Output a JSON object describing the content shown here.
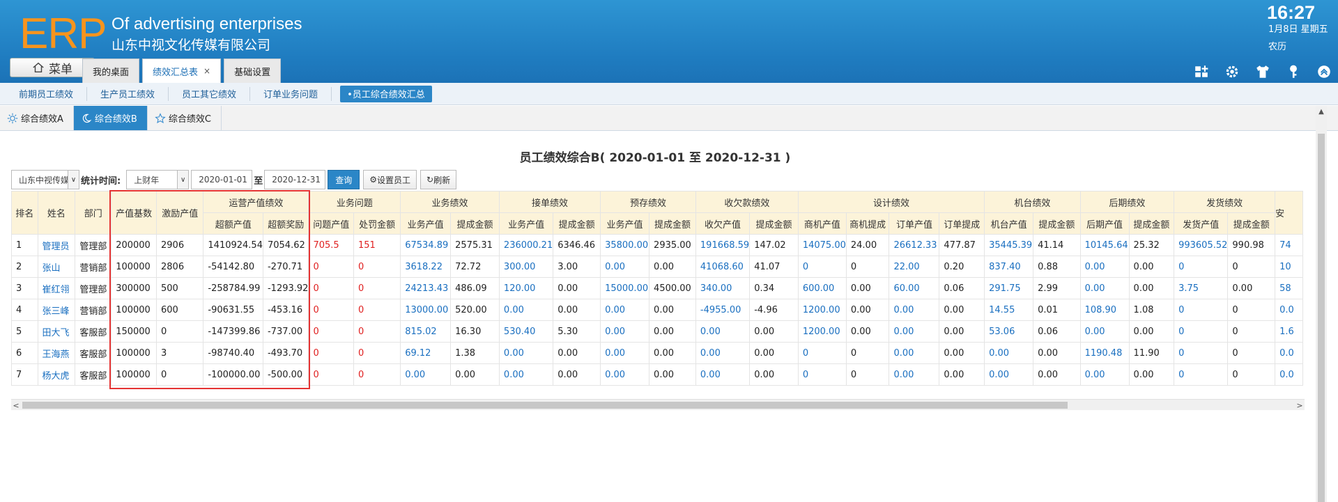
{
  "header": {
    "logo": "ERP",
    "brand_en": "Of advertising enterprises",
    "brand_cn": "山东中视文化传媒有限公司",
    "time": "16:27",
    "date": "1月8日 星期五",
    "lunar": "农历",
    "menu_label": "菜单",
    "tabs": [
      {
        "label": "我的桌面"
      },
      {
        "label": "绩效汇总表",
        "close": "×"
      },
      {
        "label": "基础设置"
      }
    ]
  },
  "subnav": [
    "前期员工绩效",
    "生产员工绩效",
    "员工其它绩效",
    "订单业务问题",
    "•员工综合绩效汇总"
  ],
  "subtabs": [
    "综合绩效A",
    "综合绩效B",
    "综合绩效C"
  ],
  "page_title": "员工绩效综合B( 2020-01-01 至 2020-12-31 )",
  "filters": {
    "company": "山东中视传媒",
    "stat_label": "统计时间:",
    "period": "上财年",
    "start_date": "2020-01-01",
    "to_label": "至",
    "end_date": "2020-12-31",
    "query": "查询",
    "set_staff": "设置员工",
    "refresh": "刷新"
  },
  "table": {
    "fixed_headers": [
      "排名",
      "姓名",
      "部门",
      "产值基数",
      "激励产值"
    ],
    "groups": [
      {
        "name": "运营产值绩效",
        "cols": [
          "超额产值",
          "超额奖励"
        ]
      },
      {
        "name": "业务问题",
        "cols": [
          "问题产值",
          "处罚金额"
        ]
      },
      {
        "name": "业务绩效",
        "cols": [
          "业务产值",
          "提成金额"
        ]
      },
      {
        "name": "接单绩效",
        "cols": [
          "业务产值",
          "提成金额"
        ]
      },
      {
        "name": "预存绩效",
        "cols": [
          "业务产值",
          "提成金额"
        ]
      },
      {
        "name": "收欠款绩效",
        "cols": [
          "收欠产值",
          "提成金额"
        ]
      },
      {
        "name": "设计绩效",
        "cols": [
          "商机产值",
          "商机提成",
          "订单产值",
          "订单提成"
        ]
      },
      {
        "name": "机台绩效",
        "cols": [
          "机台产值",
          "提成金额"
        ]
      },
      {
        "name": "后期绩效",
        "cols": [
          "后期产值",
          "提成金额"
        ]
      },
      {
        "name": "发货绩效",
        "cols": [
          "发货产值",
          "提成金额"
        ]
      }
    ],
    "partial_header": "安",
    "rows": [
      {
        "rank": "1",
        "name": "管理员",
        "dept": "管理部",
        "base": "200000",
        "incentive": "2906",
        "vals": [
          "1410924.54",
          "7054.62",
          "705.5",
          "151",
          "67534.89",
          "2575.31",
          "236000.21",
          "6346.46",
          "35800.00",
          "2935.00",
          "191668.59",
          "147.02",
          "14075.00",
          "24.00",
          "26612.33",
          "477.87",
          "35445.39",
          "41.14",
          "10145.64",
          "25.32",
          "993605.52",
          "990.98",
          "74"
        ]
      },
      {
        "rank": "2",
        "name": "张山",
        "dept": "营销部",
        "base": "100000",
        "incentive": "2806",
        "vals": [
          "-54142.80",
          "-270.71",
          "0",
          "0",
          "3618.22",
          "72.72",
          "300.00",
          "3.00",
          "0.00",
          "0.00",
          "41068.60",
          "41.07",
          "0",
          "0",
          "22.00",
          "0.20",
          "837.40",
          "0.88",
          "0.00",
          "0.00",
          "0",
          "0",
          "10"
        ]
      },
      {
        "rank": "3",
        "name": "崔红翎",
        "dept": "管理部",
        "base": "300000",
        "incentive": "500",
        "vals": [
          "-258784.99",
          "-1293.92",
          "0",
          "0",
          "24213.43",
          "486.09",
          "120.00",
          "0.00",
          "15000.00",
          "4500.00",
          "340.00",
          "0.34",
          "600.00",
          "0.00",
          "60.00",
          "0.06",
          "291.75",
          "2.99",
          "0.00",
          "0.00",
          "3.75",
          "0.00",
          "58"
        ]
      },
      {
        "rank": "4",
        "name": "张三峰",
        "dept": "营销部",
        "base": "100000",
        "incentive": "600",
        "vals": [
          "-90631.55",
          "-453.16",
          "0",
          "0",
          "13000.00",
          "520.00",
          "0.00",
          "0.00",
          "0.00",
          "0.00",
          "-4955.00",
          "-4.96",
          "1200.00",
          "0.00",
          "0.00",
          "0.00",
          "14.55",
          "0.01",
          "108.90",
          "1.08",
          "0",
          "0",
          "0.0"
        ]
      },
      {
        "rank": "5",
        "name": "田大飞",
        "dept": "客服部",
        "base": "150000",
        "incentive": "0",
        "vals": [
          "-147399.86",
          "-737.00",
          "0",
          "0",
          "815.02",
          "16.30",
          "530.40",
          "5.30",
          "0.00",
          "0.00",
          "0.00",
          "0.00",
          "1200.00",
          "0.00",
          "0.00",
          "0.00",
          "53.06",
          "0.06",
          "0.00",
          "0.00",
          "0",
          "0",
          "1.6"
        ]
      },
      {
        "rank": "6",
        "name": "王海燕",
        "dept": "客服部",
        "base": "100000",
        "incentive": "3",
        "vals": [
          "-98740.40",
          "-493.70",
          "0",
          "0",
          "69.12",
          "1.38",
          "0.00",
          "0.00",
          "0.00",
          "0.00",
          "0.00",
          "0.00",
          "0",
          "0",
          "0.00",
          "0.00",
          "0.00",
          "0.00",
          "1190.48",
          "11.90",
          "0",
          "0",
          "0.0"
        ]
      },
      {
        "rank": "7",
        "name": "杨大虎",
        "dept": "客服部",
        "base": "100000",
        "incentive": "0",
        "vals": [
          "-100000.00",
          "-500.00",
          "0",
          "0",
          "0.00",
          "0.00",
          "0.00",
          "0.00",
          "0.00",
          "0.00",
          "0.00",
          "0.00",
          "0",
          "0",
          "0.00",
          "0.00",
          "0.00",
          "0.00",
          "0.00",
          "0.00",
          "0",
          "0",
          "0.0"
        ]
      }
    ]
  },
  "colors": {
    "accent": "#2b86c7",
    "logo": "#f7941d",
    "link": "#1a6fc0",
    "warning": "#e02020",
    "highlight_box": "#e53333"
  },
  "icons": [
    "home-icon",
    "grid-add-icon",
    "gear-icon",
    "shirt-icon",
    "key-icon",
    "collapse-up-icon",
    "sun-icon",
    "moon-icon",
    "star-icon",
    "refresh-icon"
  ]
}
